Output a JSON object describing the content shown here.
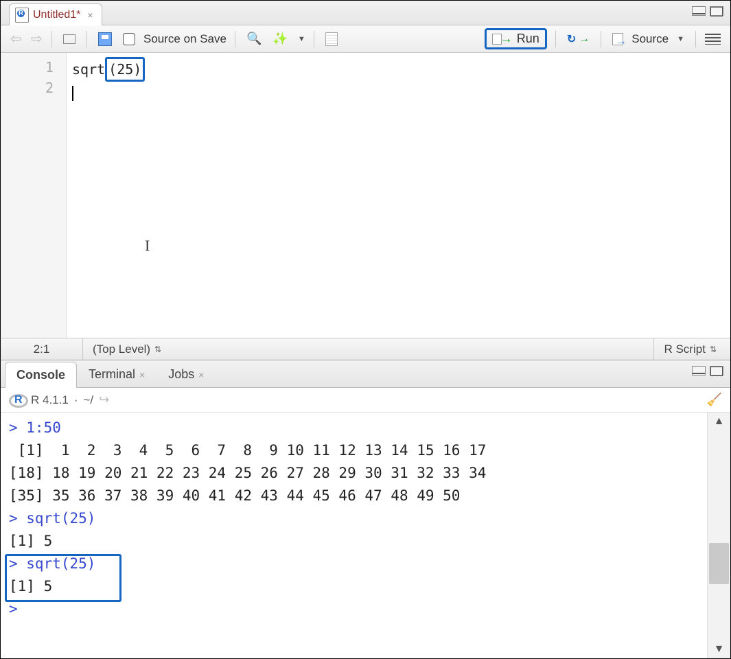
{
  "source": {
    "tab_title": "Untitled1*",
    "toolbar": {
      "source_on_save_label": "Source on Save",
      "run_label": "Run",
      "source_label": "Source"
    },
    "code": {
      "line1_prefix": "sqrt",
      "line1_highlight": "(25)",
      "line_numbers": [
        "1",
        "2"
      ]
    },
    "statusbar": {
      "position": "2:1",
      "scope": "(Top Level)",
      "language": "R Script"
    }
  },
  "console": {
    "tabs": {
      "console": "Console",
      "terminal": "Terminal",
      "jobs": "Jobs"
    },
    "header": {
      "version": "R 4.1.1",
      "sep": "·",
      "path": "~/"
    },
    "output": {
      "l1": "> 1:50",
      "l2": " [1]  1  2  3  4  5  6  7  8  9 10 11 12 13 14 15 16 17",
      "l3": "[18] 18 19 20 21 22 23 24 25 26 27 28 29 30 31 32 33 34",
      "l4": "[35] 35 36 37 38 39 40 41 42 43 44 45 46 47 48 49 50",
      "l5": "> sqrt(25)",
      "l6": "[1] 5",
      "l7": "> sqrt(25)",
      "l8": "[1] 5",
      "l9": "> "
    }
  }
}
